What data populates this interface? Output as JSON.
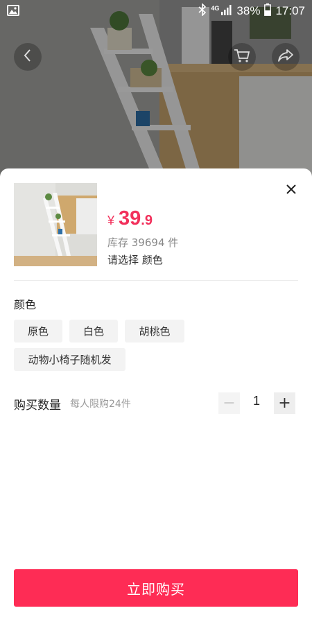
{
  "status_bar": {
    "network": "4G",
    "battery": "38%",
    "time": "17:07"
  },
  "icons": {
    "gallery": "image-icon",
    "bluetooth": "bluetooth-icon",
    "signal": "signal-icon",
    "battery": "battery-icon",
    "back": "back-arrow-icon",
    "cart": "cart-icon",
    "share": "share-icon",
    "close": "close-icon"
  },
  "product": {
    "price_symbol": "¥",
    "price_integer": "39",
    "price_decimal": ".9",
    "stock": "库存 39694 件",
    "select_hint": "请选择 颜色"
  },
  "color_section": {
    "title": "颜色",
    "options": [
      "原色",
      "白色",
      "胡桃色",
      "动物小椅子随机发"
    ]
  },
  "quantity": {
    "title": "购买数量",
    "limit": "每人限购24件",
    "minus": "−",
    "value": "1",
    "plus": "+"
  },
  "buy_button": "立即购买",
  "colors": {
    "accent": "#fe2c55",
    "price": "#f2305b"
  }
}
